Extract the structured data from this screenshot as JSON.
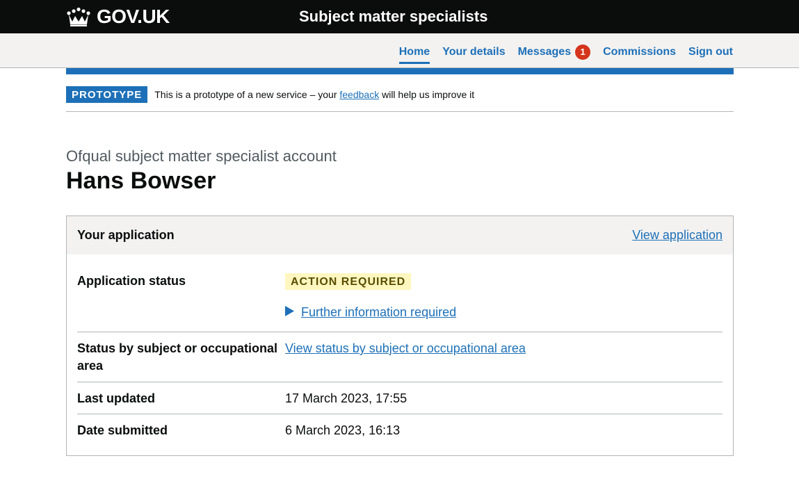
{
  "header": {
    "logo_text": "GOV.UK",
    "service_name": "Subject matter specialists"
  },
  "nav": {
    "items": [
      {
        "label": "Home",
        "active": true
      },
      {
        "label": "Your details"
      },
      {
        "label": "Messages",
        "badge": "1"
      },
      {
        "label": "Commissions"
      },
      {
        "label": "Sign out"
      }
    ]
  },
  "phase_banner": {
    "tag": "PROTOTYPE",
    "text_before": "This is a prototype of a new service – your",
    "link": "feedback",
    "text_after": "will help us improve it"
  },
  "page": {
    "caption": "Ofqual subject matter specialist account",
    "title": "Hans Bowser"
  },
  "card": {
    "title": "Your application",
    "action": "View application",
    "rows": [
      {
        "key": "Application status",
        "tag": "ACTION REQUIRED",
        "details": "Further information required"
      },
      {
        "key": "Status by subject or occupational area",
        "link": "View status by subject or occupational area"
      },
      {
        "key": "Last updated",
        "value": "17 March 2023, 17:55"
      },
      {
        "key": "Date submitted",
        "value": "6 March 2023, 16:13"
      }
    ]
  },
  "colors": {
    "header_bg": "#0b0c0c",
    "link_blue": "#1d70b8",
    "badge_red": "#d4351c",
    "tag_yellow_bg": "#fff7bf",
    "tag_yellow_text": "#594d00"
  },
  "icons": [
    "crown-icon",
    "triangle-right-icon"
  ]
}
